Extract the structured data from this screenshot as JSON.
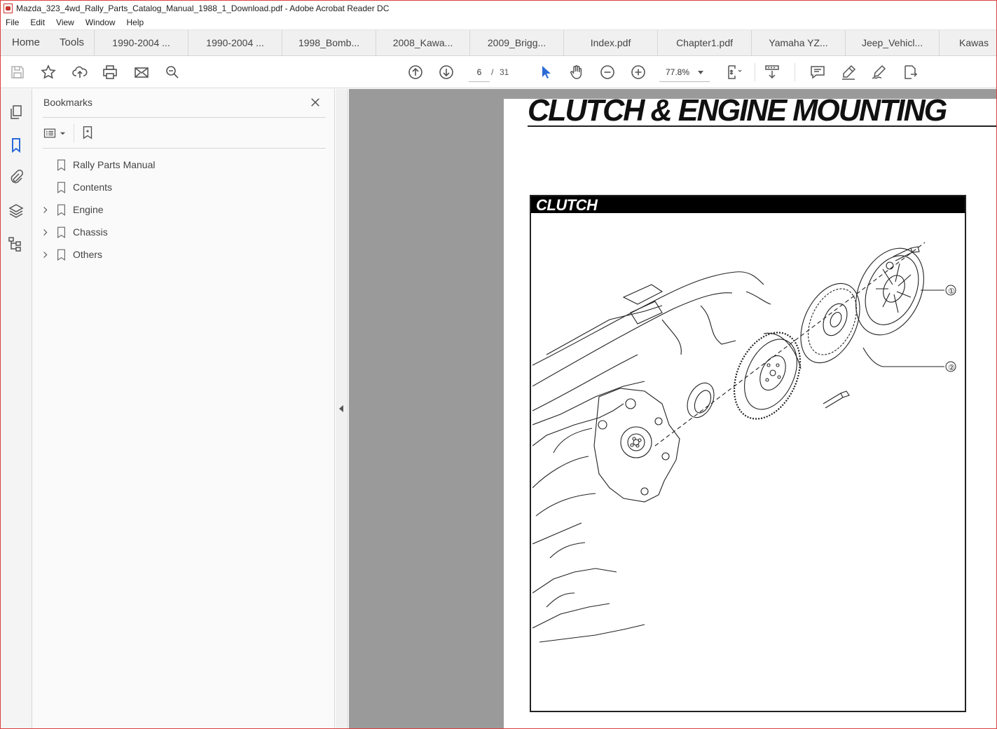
{
  "window": {
    "title": "Mazda_323_4wd_Rally_Parts_Catalog_Manual_1988_1_Download.pdf - Adobe Acrobat Reader DC"
  },
  "menu": [
    "File",
    "Edit",
    "View",
    "Window",
    "Help"
  ],
  "nav_tabs": {
    "home": "Home",
    "tools": "Tools"
  },
  "doc_tabs": [
    "1990-2004 ...",
    "1990-2004 ...",
    "1998_Bomb...",
    "2008_Kawa...",
    "2009_Brigg...",
    "Index.pdf",
    "Chapter1.pdf",
    "Yamaha YZ...",
    "Jeep_Vehicl...",
    "Kawas"
  ],
  "toolbar": {
    "page_current": "6",
    "page_separator": "/",
    "page_total": "31",
    "zoom": "77.8%"
  },
  "bookmarks_panel": {
    "title": "Bookmarks",
    "items": [
      {
        "label": "Rally Parts Manual",
        "expandable": false
      },
      {
        "label": "Contents",
        "expandable": false
      },
      {
        "label": "Engine",
        "expandable": true
      },
      {
        "label": "Chassis",
        "expandable": true
      },
      {
        "label": "Others",
        "expandable": true
      }
    ]
  },
  "document": {
    "heading": "CLUTCH & ENGINE MOUNTING",
    "section": "CLUTCH",
    "callouts": [
      "①",
      "②"
    ]
  },
  "colors": {
    "accent_blue": "#2b6bd6",
    "window_border": "#d94040",
    "doc_background": "#9a9a9a"
  },
  "icons": {
    "toolbar_left": [
      "save-icon",
      "star-icon",
      "upload-icon",
      "print-icon",
      "mail-icon",
      "search-zoom-icon"
    ],
    "toolbar_center": [
      "page-up-icon",
      "page-down-icon",
      "select-cursor-icon",
      "hand-icon",
      "zoom-out-icon",
      "zoom-in-icon"
    ],
    "toolbar_right": [
      "fit-page-icon",
      "scroll-mode-icon",
      "comment-icon",
      "highlight-icon",
      "sign-icon",
      "share-icon"
    ],
    "rail": [
      "pages-icon",
      "bookmark-icon",
      "attachment-icon",
      "layers-icon",
      "tags-icon"
    ]
  }
}
